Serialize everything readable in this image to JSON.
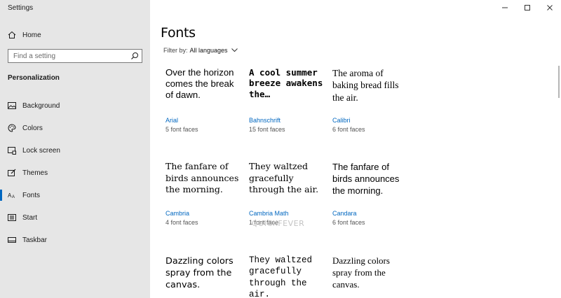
{
  "app": {
    "title": "Settings"
  },
  "sidebar": {
    "home_label": "Home",
    "search_placeholder": "Find a setting",
    "section_title": "Personalization",
    "items": [
      {
        "label": "Background",
        "icon": "picture-icon"
      },
      {
        "label": "Colors",
        "icon": "palette-icon"
      },
      {
        "label": "Lock screen",
        "icon": "lock-screen-icon"
      },
      {
        "label": "Themes",
        "icon": "themes-icon"
      },
      {
        "label": "Fonts",
        "icon": "fonts-icon",
        "active": true
      },
      {
        "label": "Start",
        "icon": "start-icon"
      },
      {
        "label": "Taskbar",
        "icon": "taskbar-icon"
      }
    ]
  },
  "main": {
    "title": "Fonts",
    "filter_label": "Filter by:",
    "filter_value": "All languages",
    "watermark": "QUICKFEVER",
    "fonts": [
      {
        "sample": "Over the horizon comes the break of dawn.",
        "name": "Arial",
        "faces": "5 font faces"
      },
      {
        "sample": "A cool summer breeze awakens the…",
        "name": "Bahnschrift",
        "faces": "15 font faces"
      },
      {
        "sample": "The aroma of baking bread fills the air.",
        "name": "Calibri",
        "faces": "6 font faces"
      },
      {
        "sample": "The fanfare of birds announces the morning.",
        "name": "Cambria",
        "faces": "4 font faces"
      },
      {
        "sample": "They waltzed gracefully through the air.",
        "name": "Cambria Math",
        "faces": "1 font face"
      },
      {
        "sample": "The fanfare of birds announces the morning.",
        "name": "Candara",
        "faces": "6 font faces"
      },
      {
        "sample": "Dazzling colors spray from the canvas.",
        "name": "",
        "faces": ""
      },
      {
        "sample": "They waltzed gracefully through the air.",
        "name": "",
        "faces": ""
      },
      {
        "sample": "Dazzling colors spray from the canvas.",
        "name": "",
        "faces": ""
      }
    ]
  },
  "colors": {
    "accent": "#0067c0",
    "sidebar_bg": "#e6e6e6"
  }
}
